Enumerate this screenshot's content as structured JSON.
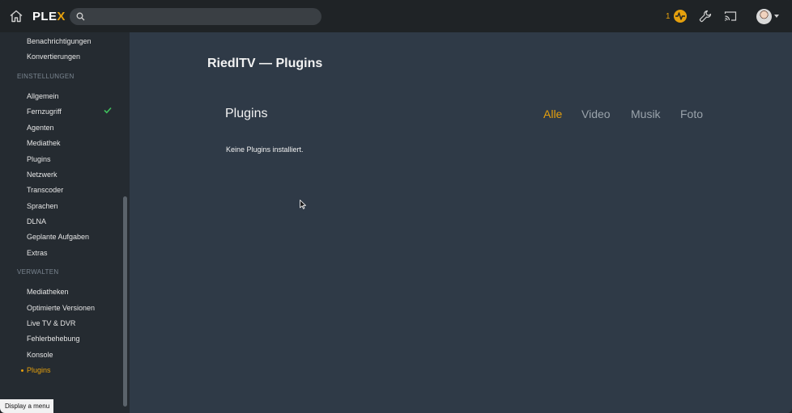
{
  "topbar": {
    "logo_text": "PLE",
    "logo_accent": "X",
    "search_placeholder": "",
    "activity_count": "1",
    "icons": [
      "home-icon",
      "search-icon",
      "activity-icon",
      "wrench-icon",
      "cast-icon",
      "avatar"
    ]
  },
  "sidebar": {
    "top_items": [
      "Benachrichtigungen",
      "Konvertierungen"
    ],
    "settings_label": "EINSTELLUNGEN",
    "settings_items": [
      "Allgemein",
      "Fernzugriff",
      "Agenten",
      "Mediathek",
      "Plugins",
      "Netzwerk",
      "Transcoder",
      "Sprachen",
      "DLNA",
      "Geplante Aufgaben",
      "Extras"
    ],
    "manage_label": "VERWALTEN",
    "manage_items": [
      "Mediatheken",
      "Optimierte Versionen",
      "Live TV & DVR",
      "Fehlerbehebung",
      "Konsole",
      "Plugins"
    ],
    "active_item": "Plugins"
  },
  "main": {
    "page_title": "RiedlTV — Plugins",
    "card_title": "Plugins",
    "tabs": [
      "Alle",
      "Video",
      "Musik",
      "Foto"
    ],
    "selected_tab": "Alle",
    "empty_message": "Keine Plugins installiert."
  },
  "tooltip": "Display a menu",
  "colors": {
    "accent": "#e5a00d",
    "topbar_bg": "#1f2326",
    "sidebar_bg": "#252b31",
    "main_bg": "#2f3a47",
    "check": "#3fbf5c"
  }
}
